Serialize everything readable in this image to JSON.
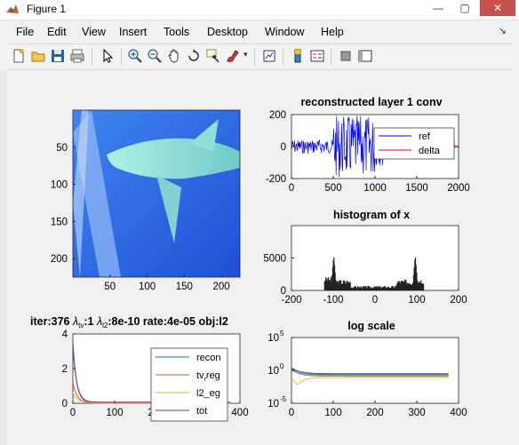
{
  "window": {
    "title": "Figure 1"
  },
  "menu": [
    "File",
    "Edit",
    "View",
    "Insert",
    "Tools",
    "Desktop",
    "Window",
    "Help"
  ],
  "subplot_image": {
    "x_ticks": [
      "50",
      "100",
      "150",
      "200"
    ],
    "y_ticks": [
      "50",
      "100",
      "150",
      "200"
    ]
  },
  "subplot_conv": {
    "title": "reconstructed layer 1 conv",
    "x_ticks": [
      "0",
      "500",
      "1000",
      "1500",
      "2000"
    ],
    "y_ticks": [
      "200",
      "0",
      "-200"
    ],
    "legend": [
      "ref",
      "delta"
    ]
  },
  "subplot_hist": {
    "title": "histogram of x",
    "x_ticks": [
      "-200",
      "-100",
      "0",
      "100",
      "200"
    ],
    "y_ticks": [
      "5000",
      "0"
    ]
  },
  "subplot_loss": {
    "title_prefix": "iter:376 ",
    "title_tv": ":1 ",
    "title_l2": ":8e-10 rate:4e-05 obj:l2",
    "lambda_sym": "λ",
    "sub_tv": "tv",
    "sub_l2": "l2",
    "x_ticks": [
      "0",
      "100",
      "200",
      "300",
      "400"
    ],
    "y_ticks": [
      "4",
      "2",
      "0"
    ],
    "legend": [
      "recon",
      "tv_reg",
      "l2_reg",
      "tot"
    ],
    "legend_shown": [
      "recon",
      "tv",
      "reg",
      "l2_eg",
      "tot"
    ]
  },
  "subplot_log": {
    "title": "log scale",
    "x_ticks": [
      "0",
      "100",
      "200",
      "300",
      "400"
    ],
    "y_ticks_base": [
      "10",
      "10"
    ],
    "y_ticks_exp": [
      "5",
      "0",
      "-5"
    ]
  },
  "chart_data": [
    {
      "type": "line",
      "title": "reconstructed layer 1 conv",
      "xlim": [
        0,
        2000
      ],
      "ylim": [
        -200,
        200
      ],
      "series": [
        {
          "name": "ref"
        },
        {
          "name": "delta"
        }
      ]
    },
    {
      "type": "bar",
      "title": "histogram of x",
      "xlim": [
        -200,
        200
      ],
      "ylim": [
        0,
        10000
      ],
      "peaks": [
        {
          "x": -100,
          "y": 5500
        },
        {
          "x": 95,
          "y": 5500
        }
      ]
    },
    {
      "type": "line",
      "title": "iter:376 λtv:1 λl2:8e-10 rate:4e-05 obj:l2",
      "xlim": [
        0,
        400
      ],
      "ylim": [
        0,
        4
      ],
      "series": [
        {
          "name": "recon",
          "color": "#0072bd"
        },
        {
          "name": "tv_reg",
          "color": "#d95319"
        },
        {
          "name": "l2_reg",
          "color": "#edb120"
        },
        {
          "name": "tot",
          "color": "#7e2f8e"
        }
      ]
    },
    {
      "type": "line",
      "title": "log scale",
      "xlim": [
        0,
        400
      ],
      "y_scale": "log",
      "ylim": [
        1e-05,
        100000
      ]
    }
  ]
}
